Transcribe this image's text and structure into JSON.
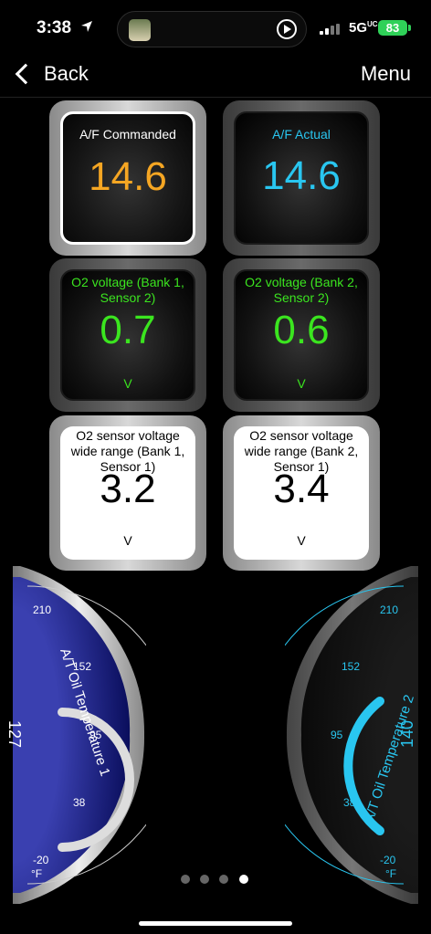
{
  "status": {
    "time": "3:38",
    "network": "5G",
    "network_sup": "UC",
    "battery": "83"
  },
  "nav": {
    "back_label": "Back",
    "menu_label": "Menu"
  },
  "tiles": [
    {
      "title": "A/F Commanded",
      "value": "14.6",
      "unit": ""
    },
    {
      "title": "A/F Actual",
      "value": "14.6",
      "unit": ""
    },
    {
      "title": "O2 voltage (Bank 1, Sensor 2)",
      "value": "0.7",
      "unit": "V"
    },
    {
      "title": "O2 voltage (Bank 2, Sensor 2)",
      "value": "0.6",
      "unit": "V"
    },
    {
      "title": "O2 sensor voltage wide range (Bank 1, Sensor 1)",
      "value": "3.2",
      "unit": "V"
    },
    {
      "title": "O2 sensor voltage wide range (Bank 2, Sensor 1)",
      "value": "3.4",
      "unit": "V"
    }
  ],
  "gauges": {
    "left": {
      "label": "A/T Oil Temperature 1",
      "value": "127",
      "unit": "°F",
      "ticks": [
        "210",
        "152",
        "95",
        "38",
        "-20"
      ],
      "min": -20,
      "max": 210
    },
    "right": {
      "label": "A/T Oil Temperature 2",
      "value": "140",
      "unit": "°F",
      "ticks": [
        "210",
        "152",
        "95",
        "38",
        "-20"
      ],
      "min": -20,
      "max": 210
    }
  },
  "colors": {
    "orange": "#f5a623",
    "cyan": "#29c6f0",
    "green": "#3be51f",
    "navy": "#0f1470"
  },
  "page_indicator": {
    "count": 4,
    "active": 4
  }
}
